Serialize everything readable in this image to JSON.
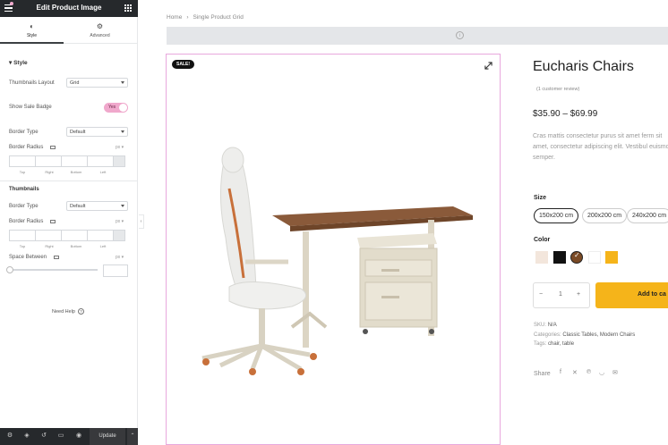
{
  "editor": {
    "title": "Edit Product Image",
    "tabs": [
      {
        "label": "Style",
        "icon": "half-circle-icon"
      },
      {
        "label": "Advanced",
        "icon": "gear-icon"
      }
    ],
    "section": "Style",
    "thumbnails_layout": {
      "label": "Thumbnails Layout",
      "value": "Grid"
    },
    "show_sale_badge": {
      "label": "Show Sale Badge",
      "value": "Yes"
    },
    "border_type": {
      "label": "Border Type",
      "value": "Default"
    },
    "border_radius": {
      "label": "Border Radius",
      "unit": "px"
    },
    "dimension_labels": [
      "Top",
      "Right",
      "Bottom",
      "Left"
    ],
    "thumbnails_heading": "Thumbnails",
    "thumb_border_type": {
      "label": "Border Type",
      "value": "Default"
    },
    "thumb_border_radius": {
      "label": "Border Radius",
      "unit": "px"
    },
    "space_between": {
      "label": "Space Between",
      "unit": "px"
    },
    "need_help": "Need Help",
    "update_label": "Update"
  },
  "page": {
    "breadcrumb": [
      "Home",
      "Single Product Grid"
    ],
    "sale_badge": "SALE!",
    "product_title": "Eucharis Chairs",
    "review": "(1 customer review)",
    "price": "$35.90 – $69.99",
    "description": "Cras mattis consectetur purus sit amet ferm sit amet, consectetur adipiscing elit. Vestibul euismod semper.",
    "size_label": "Size",
    "sizes": [
      "150x200 cm",
      "200x200 cm",
      "240x200 cm"
    ],
    "selected_size": "150x200 cm",
    "color_label": "Color",
    "colors": [
      "#f3e6dc",
      "#111111",
      "#7a4a25",
      "#ffffff",
      "#f5b41a"
    ],
    "selected_color_index": 2,
    "quantity": "1",
    "add_to_cart": "Add to ca",
    "sku_label": "SKU:",
    "sku_value": "N/A",
    "categories_label": "Categories:",
    "categories_value": "Classic Tables, Modern Chairs",
    "tags_label": "Tags:",
    "tags_value": "chair, table",
    "share_label": "Share",
    "accent": "#f5b41a"
  }
}
